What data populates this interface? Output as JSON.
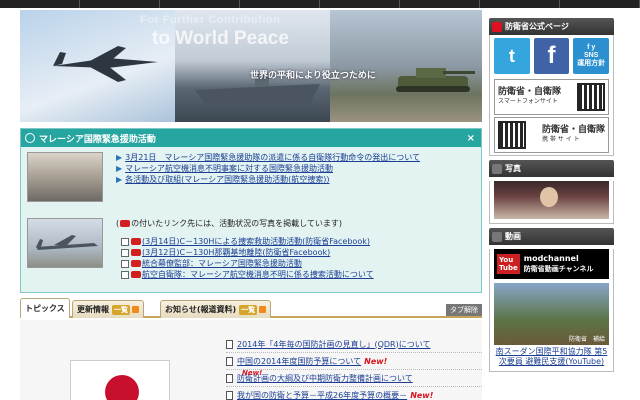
{
  "banner": {
    "tagline_en_1": "For Further Contribution",
    "tagline_en_2": "to World Peace",
    "tagline_jp": "世界の平和により役立つために"
  },
  "notice": {
    "title": "マレーシア国際緊急援助活動",
    "close": "×",
    "links_primary": [
      "3月21日　マレーシア国際緊急援助隊の派遣に係る自衛隊行動命令の発出について",
      "マレーシア航空機消息不明事案に対する国際緊急援助活動",
      "各活動及び取組(マレーシア国際緊急援助活動(航空捜索))"
    ],
    "photo_note": "の付いたリンク先には、活動状況の写真を掲載しています",
    "links_photo": [
      "(3月14日)C－130Hによる捜索救助活動活動(防衛省Facebook)",
      "(3月12日)C－130H那覇基地離陸(防衛省Facebook)",
      "統合幕僚監部：マレーシア国際緊急援助活動",
      "航空自衛隊：マレーシア航空機消息不明に係る捜索活動について"
    ]
  },
  "tabs": {
    "topics": "トピックス",
    "updates": "更新情報",
    "updates_pill": "一覧",
    "press": "お知らせ(報道資料)",
    "press_pill": "一覧",
    "clear": "タブ解除"
  },
  "news": {
    "items": [
      "2014年「4年毎の国防計画の見直し」(QDR)について",
      "中国の2014年度国防予算について",
      "防衛計画の大綱及び中期防衛力整備計画について",
      "我が国の防衛と予算－平成26年度予算の概要－"
    ],
    "new_badge": "New!"
  },
  "sidebar": {
    "official_title": "防衛省公式ページ",
    "fy_line1": "f y",
    "fy_line2": "SNS",
    "fy_line3": "運用方針",
    "smartphone_title": "防衛省・自衛隊",
    "smartphone_sub": "スマートフォンサイト",
    "mobile_title": "防衛省・自衛隊",
    "mobile_sub": "携 帯 サ イ ト",
    "photo_title": "写真",
    "video_title": "動画",
    "yt_logo_1": "You",
    "yt_logo_2": "Tube",
    "yt_channel": "modchannel",
    "yt_channel_sub": "防衛省動画チャンネル",
    "video_caption": "防衛省　補給",
    "video_link": "南スーダン国際平和協力隊 第5次要員 避難民支援(YouTube)"
  }
}
